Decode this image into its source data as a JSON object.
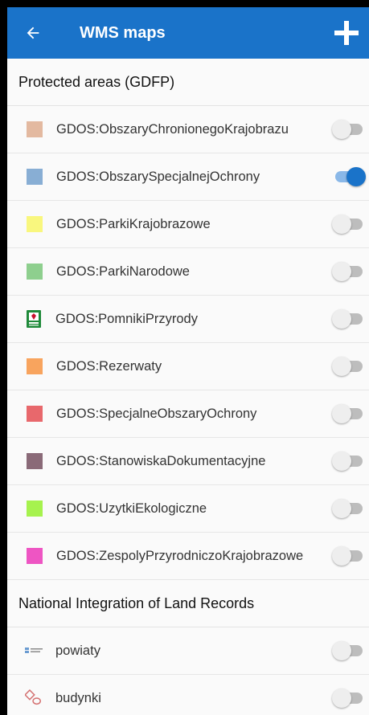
{
  "appbar": {
    "title": "WMS maps",
    "back_icon": "back-arrow-icon",
    "add_icon": "plus-icon",
    "color": "#1a73c9"
  },
  "sections": [
    {
      "header": "Protected areas (GDFP)",
      "items": [
        {
          "label": "GDOS:ObszaryChronionegoKrajobrazu",
          "swatch": "#e3b9a0",
          "enabled": false
        },
        {
          "label": "GDOS:ObszarySpecjalnejOchrony",
          "swatch": "#88aed4",
          "enabled": true
        },
        {
          "label": "GDOS:ParkiKrajobrazowe",
          "swatch": "#f9f77e",
          "enabled": false
        },
        {
          "label": "GDOS:ParkiNarodowe",
          "swatch": "#8ecf8e",
          "enabled": false
        },
        {
          "label": "GDOS:PomnikiPrzyrody",
          "icon": "green-emblem-icon",
          "enabled": false
        },
        {
          "label": "GDOS:Rezerwaty",
          "swatch": "#f8a45e",
          "enabled": false
        },
        {
          "label": "GDOS:SpecjalneObszaryOchrony",
          "swatch": "#e8686c",
          "enabled": false
        },
        {
          "label": "GDOS:StanowiskaDokumentacyjne",
          "swatch": "#8a6a78",
          "enabled": false
        },
        {
          "label": "GDOS:UzytkiEkologiczne",
          "swatch": "#a6f24e",
          "enabled": false
        },
        {
          "label": "GDOS:ZespolyPrzyrodniczoKrajobrazowe",
          "swatch": "#ee55c3",
          "enabled": false
        }
      ]
    },
    {
      "header": "National Integration of Land Records",
      "items": [
        {
          "label": "powiaty",
          "icon": "powiaty-logo-icon",
          "enabled": false
        },
        {
          "label": "budynki",
          "icon": "budynki-logo-icon",
          "enabled": false
        }
      ]
    }
  ]
}
